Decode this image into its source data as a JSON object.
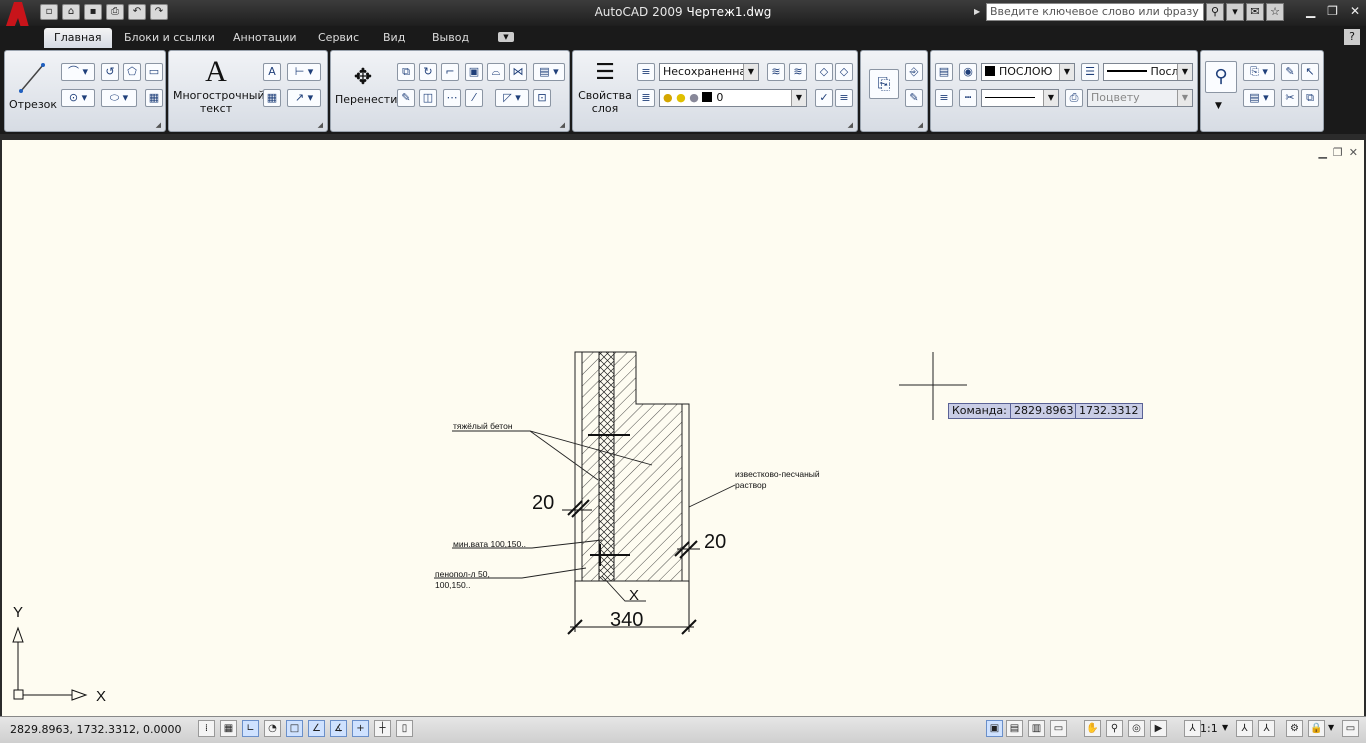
{
  "app": {
    "title_app": "AutoCAD 2009",
    "title_doc": "Чертеж1.dwg",
    "search_placeholder": "Введите ключевое слово или фразу",
    "logo_letter": "A"
  },
  "tabs": [
    {
      "label": "Главная",
      "active": true
    },
    {
      "label": "Блоки и ссылки",
      "active": false
    },
    {
      "label": "Аннотации",
      "active": false
    },
    {
      "label": "Сервис",
      "active": false
    },
    {
      "label": "Вид",
      "active": false
    },
    {
      "label": "Вывод",
      "active": false
    }
  ],
  "ribbon": {
    "line_label": "Отрезок",
    "mtext_label_1": "Многострочный",
    "mtext_label_2": "текст",
    "move_label": "Перенести",
    "layer_props_1": "Свойства",
    "layer_props_2": "слоя",
    "layer_state": "Несохраненная",
    "layer_current": "0",
    "color_value": "ПОСЛОЮ",
    "lineweight_value": "Посло",
    "linetype_value": "",
    "plotstyle_value": "Поцвету"
  },
  "drawing": {
    "label_concrete": "тяжёлый  бетон",
    "label_mortar_1": "известково-песчаный",
    "label_mortar_2": "раствор",
    "label_minwool": "мин.вата  100,150..",
    "label_foam_1": "пенопол-л  50,",
    "label_foam_2": "100,150..",
    "dim_left": "20",
    "dim_right": "20",
    "dim_total": "340",
    "axis_label_x": "X",
    "ucs_x": "X",
    "ucs_y": "Y"
  },
  "tooltip": {
    "prompt": "Команда:",
    "x": "2829.8963",
    "y": "1732.3312"
  },
  "status": {
    "coordinates": "2829.8963, 1732.3312, 0.0000",
    "scale": "1:1"
  }
}
